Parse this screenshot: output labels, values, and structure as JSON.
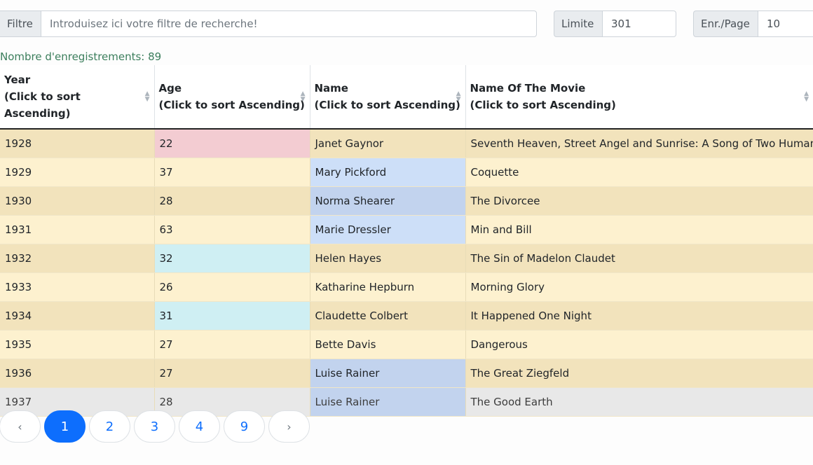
{
  "filter": {
    "label": "Filtre",
    "placeholder": "Introduisez ici votre filtre de recherche!",
    "value": ""
  },
  "limit": {
    "label": "Limite",
    "value": "301"
  },
  "per_page": {
    "label": "Enr./Page",
    "value": "10"
  },
  "record_count": "Nombre d'enregistrements: 89",
  "columns": [
    {
      "title": "Year",
      "sort_hint": "(Click to sort Ascending)"
    },
    {
      "title": "Age",
      "sort_hint": "(Click to sort Ascending)"
    },
    {
      "title": "Name",
      "sort_hint": "(Click to sort Ascending)"
    },
    {
      "title": "Name Of The Movie",
      "sort_hint": "(Click to sort Ascending)"
    }
  ],
  "rows": [
    {
      "year": "1928",
      "age": "22",
      "name": "Janet Gaynor",
      "movie": "Seventh Heaven, Street Angel and Sunrise: A Song of Two Humans"
    },
    {
      "year": "1929",
      "age": "37",
      "name": "Mary Pickford",
      "movie": "Coquette"
    },
    {
      "year": "1930",
      "age": "28",
      "name": "Norma Shearer",
      "movie": "The Divorcee"
    },
    {
      "year": "1931",
      "age": "63",
      "name": "Marie Dressler",
      "movie": "Min and Bill"
    },
    {
      "year": "1932",
      "age": "32",
      "name": "Helen Hayes",
      "movie": "The Sin of Madelon Claudet"
    },
    {
      "year": "1933",
      "age": "26",
      "name": "Katharine Hepburn",
      "movie": "Morning Glory"
    },
    {
      "year": "1934",
      "age": "31",
      "name": "Claudette Colbert",
      "movie": "It Happened One Night"
    },
    {
      "year": "1935",
      "age": "27",
      "name": "Bette Davis",
      "movie": "Dangerous"
    },
    {
      "year": "1936",
      "age": "27",
      "name": "Luise Rainer",
      "movie": "The Great Ziegfeld"
    },
    {
      "year": "1937",
      "age": "28",
      "name": "Luise Rainer",
      "movie": "The Good Earth"
    }
  ],
  "pagination": {
    "prev": "‹",
    "pages": [
      "1",
      "2",
      "3",
      "4",
      "9"
    ],
    "next": "›",
    "active": "1"
  },
  "colors": {
    "accent": "#0d6efd",
    "count_text": "#3b7e5c",
    "row_odd": "#f2e3bc",
    "row_even": "#fdf1cf"
  }
}
